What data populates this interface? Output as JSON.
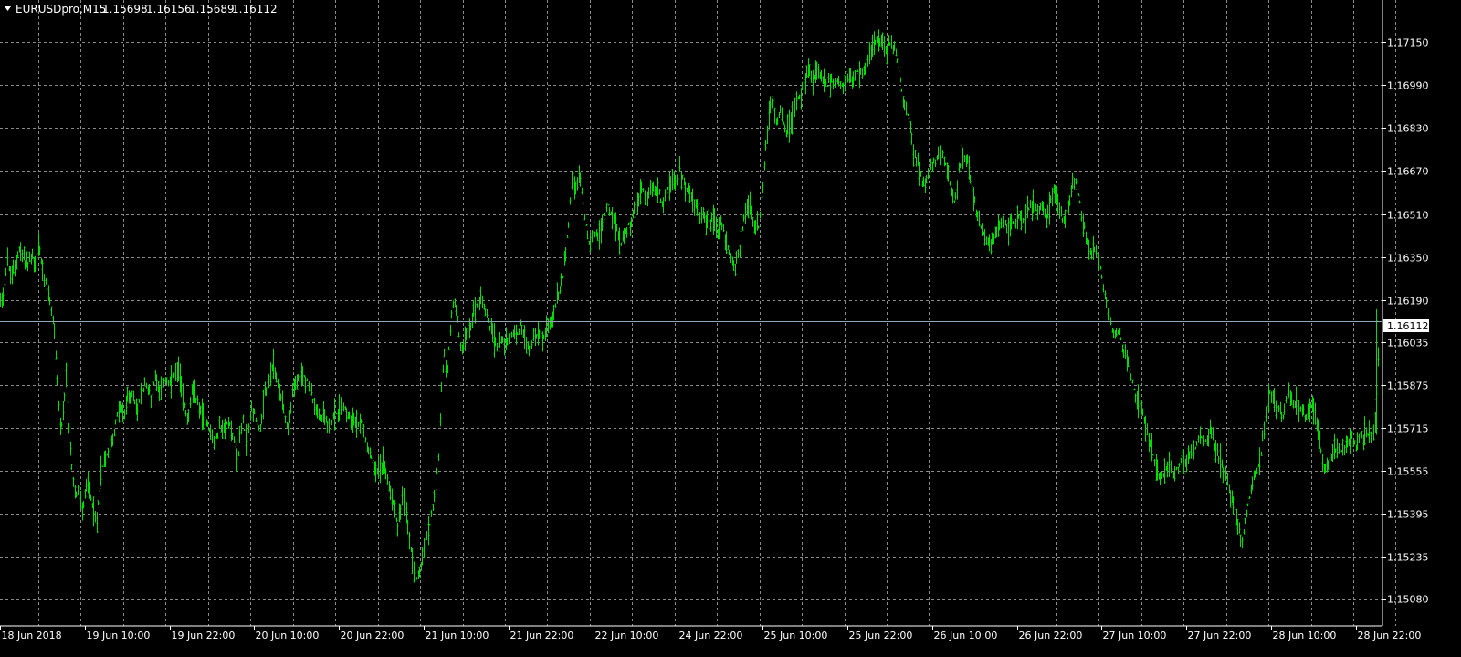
{
  "chart_window": {
    "symbol_label": "EURUSDpro,M15",
    "ohlc": [
      "1.15698",
      "1.16156",
      "1.15689",
      "1.16112"
    ],
    "current_price_label": "1.16112",
    "colors": {
      "background": "#000000",
      "bars": "#00dd00",
      "grid": "#8a8a8a",
      "text": "#ffffff",
      "current_price_line": "#8fa6b4"
    },
    "icons": {
      "collapse": "triangle-down-icon"
    }
  },
  "chart_data": {
    "type": "ohlc_bar",
    "title": "EURUSDpro,M15",
    "timeframe": "M15",
    "grid": true,
    "price_axis": {
      "position": "right",
      "ticks": [
        "1.17150",
        "1.16990",
        "1.16830",
        "1.16670",
        "1.16510",
        "1.16350",
        "1.16190",
        "1.16035",
        "1.15875",
        "1.15715",
        "1.15555",
        "1.15395",
        "1.15235",
        "1.15080"
      ],
      "range": [
        1.15,
        1.1735
      ]
    },
    "time_axis": {
      "position": "bottom",
      "ticks": [
        "18 Jun 2018",
        "19 Jun 10:00",
        "19 Jun 22:00",
        "20 Jun 10:00",
        "20 Jun 22:00",
        "21 Jun 10:00",
        "21 Jun 22:00",
        "22 Jun 10:00",
        "24 Jun 22:00",
        "25 Jun 10:00",
        "25 Jun 22:00",
        "26 Jun 10:00",
        "26 Jun 22:00",
        "27 Jun 10:00",
        "27 Jun 22:00",
        "28 Jun 10:00",
        "28 Jun 22:00"
      ]
    },
    "last_bar": {
      "open": 1.15698,
      "high": 1.16156,
      "low": 1.15689,
      "close": 1.16112
    },
    "current_price": 1.16112,
    "price_path": [
      [
        0,
        1.162
      ],
      [
        4,
        1.1622
      ],
      [
        8,
        1.1635
      ],
      [
        11,
        1.1627
      ],
      [
        15,
        1.163
      ],
      [
        20,
        1.1638
      ],
      [
        25,
        1.1635
      ],
      [
        30,
        1.1632
      ],
      [
        35,
        1.1636
      ],
      [
        38,
        1.163
      ],
      [
        42,
        1.164
      ],
      [
        47,
        1.1628
      ],
      [
        52,
        1.1622
      ],
      [
        56,
        1.1615
      ],
      [
        60,
        1.1605
      ],
      [
        63,
        1.1585
      ],
      [
        66,
        1.157
      ],
      [
        69,
        1.1575
      ],
      [
        72,
        1.159
      ],
      [
        75,
        1.1572
      ],
      [
        78,
        1.1558
      ],
      [
        82,
        1.1545
      ],
      [
        86,
        1.155
      ],
      [
        90,
        1.154
      ],
      [
        95,
        1.1552
      ],
      [
        100,
        1.1545
      ],
      [
        105,
        1.1535
      ],
      [
        110,
        1.1555
      ],
      [
        115,
        1.156
      ],
      [
        120,
        1.1565
      ],
      [
        125,
        1.157
      ],
      [
        130,
        1.158
      ],
      [
        135,
        1.1575
      ],
      [
        140,
        1.1585
      ],
      [
        145,
        1.1583
      ],
      [
        150,
        1.1578
      ],
      [
        155,
        1.1585
      ],
      [
        160,
        1.1588
      ],
      [
        165,
        1.1582
      ],
      [
        170,
        1.1592
      ],
      [
        175,
        1.1585
      ],
      [
        180,
        1.159
      ],
      [
        185,
        1.1587
      ],
      [
        190,
        1.159
      ],
      [
        195,
        1.1593
      ],
      [
        200,
        1.1583
      ],
      [
        205,
        1.1575
      ],
      [
        210,
        1.1585
      ],
      [
        215,
        1.1582
      ],
      [
        220,
        1.1577
      ],
      [
        225,
        1.1575
      ],
      [
        230,
        1.157
      ],
      [
        235,
        1.1565
      ],
      [
        240,
        1.1572
      ],
      [
        245,
        1.157
      ],
      [
        250,
        1.1575
      ],
      [
        255,
        1.1568
      ],
      [
        260,
        1.156
      ],
      [
        265,
        1.1575
      ],
      [
        270,
        1.1565
      ],
      [
        275,
        1.158
      ],
      [
        280,
        1.1575
      ],
      [
        285,
        1.157
      ],
      [
        290,
        1.1585
      ],
      [
        295,
        1.159
      ],
      [
        300,
        1.1595
      ],
      [
        305,
        1.1585
      ],
      [
        310,
        1.158
      ],
      [
        315,
        1.157
      ],
      [
        320,
        1.1585
      ],
      [
        325,
        1.1588
      ],
      [
        330,
        1.1592
      ],
      [
        335,
        1.159
      ],
      [
        340,
        1.1585
      ],
      [
        345,
        1.1578
      ],
      [
        350,
        1.1575
      ],
      [
        355,
        1.1577
      ],
      [
        360,
        1.1572
      ],
      [
        365,
        1.1575
      ],
      [
        370,
        1.1578
      ],
      [
        375,
        1.158
      ],
      [
        380,
        1.1578
      ],
      [
        385,
        1.1575
      ],
      [
        390,
        1.1572
      ],
      [
        395,
        1.1575
      ],
      [
        400,
        1.1568
      ],
      [
        405,
        1.1562
      ],
      [
        410,
        1.1558
      ],
      [
        415,
        1.1555
      ],
      [
        420,
        1.156
      ],
      [
        425,
        1.155
      ],
      [
        430,
        1.1545
      ],
      [
        435,
        1.1535
      ],
      [
        440,
        1.1545
      ],
      [
        445,
        1.154
      ],
      [
        450,
        1.1525
      ],
      [
        455,
        1.1515
      ],
      [
        460,
        1.152
      ],
      [
        465,
        1.1528
      ],
      [
        470,
        1.1535
      ],
      [
        475,
        1.1545
      ],
      [
        480,
        1.156
      ],
      [
        483,
        1.1585
      ],
      [
        486,
        1.16
      ],
      [
        489,
        1.159
      ],
      [
        492,
        1.1605
      ],
      [
        495,
        1.1615
      ],
      [
        498,
        1.162
      ],
      [
        501,
        1.161
      ],
      [
        505,
        1.16
      ],
      [
        510,
        1.1605
      ],
      [
        515,
        1.161
      ],
      [
        520,
        1.1615
      ],
      [
        525,
        1.162
      ],
      [
        530,
        1.1615
      ],
      [
        535,
        1.161
      ],
      [
        540,
        1.1605
      ],
      [
        545,
        1.1602
      ],
      [
        550,
        1.1605
      ],
      [
        555,
        1.1603
      ],
      [
        560,
        1.1607
      ],
      [
        565,
        1.1605
      ],
      [
        570,
        1.161
      ],
      [
        575,
        1.1605
      ],
      [
        580,
        1.16
      ],
      [
        585,
        1.1605
      ],
      [
        590,
        1.1607
      ],
      [
        595,
        1.1605
      ],
      [
        600,
        1.161
      ],
      [
        605,
        1.1612
      ],
      [
        610,
        1.162
      ],
      [
        615,
        1.1625
      ],
      [
        620,
        1.164
      ],
      [
        623,
        1.165
      ],
      [
        626,
        1.1665
      ],
      [
        630,
        1.166
      ],
      [
        635,
        1.1665
      ],
      [
        640,
        1.165
      ],
      [
        645,
        1.164
      ],
      [
        650,
        1.1645
      ],
      [
        655,
        1.1642
      ],
      [
        660,
        1.1648
      ],
      [
        665,
        1.1655
      ],
      [
        670,
        1.165
      ],
      [
        675,
        1.1645
      ],
      [
        680,
        1.164
      ],
      [
        685,
        1.1645
      ],
      [
        690,
        1.1648
      ],
      [
        695,
        1.1652
      ],
      [
        700,
        1.1658
      ],
      [
        705,
        1.166
      ],
      [
        710,
        1.1658
      ],
      [
        715,
        1.1662
      ],
      [
        720,
        1.166
      ],
      [
        725,
        1.1655
      ],
      [
        730,
        1.166
      ],
      [
        735,
        1.1662
      ],
      [
        740,
        1.1665
      ],
      [
        745,
        1.1667
      ],
      [
        750,
        1.1662
      ],
      [
        755,
        1.1658
      ],
      [
        760,
        1.1655
      ],
      [
        765,
        1.1652
      ],
      [
        770,
        1.165
      ],
      [
        775,
        1.1648
      ],
      [
        780,
        1.165
      ],
      [
        785,
        1.1645
      ],
      [
        790,
        1.1648
      ],
      [
        795,
        1.164
      ],
      [
        800,
        1.1635
      ],
      [
        805,
        1.163
      ],
      [
        810,
        1.164
      ],
      [
        815,
        1.165
      ],
      [
        820,
        1.1655
      ],
      [
        825,
        1.1648
      ],
      [
        830,
        1.1645
      ],
      [
        835,
        1.166
      ],
      [
        838,
        1.1675
      ],
      [
        842,
        1.169
      ],
      [
        846,
        1.1695
      ],
      [
        850,
        1.1685
      ],
      [
        855,
        1.169
      ],
      [
        860,
        1.168
      ],
      [
        865,
        1.1685
      ],
      [
        870,
        1.169
      ],
      [
        875,
        1.1695
      ],
      [
        880,
        1.17
      ],
      [
        885,
        1.1705
      ],
      [
        890,
        1.17
      ],
      [
        895,
        1.1705
      ],
      [
        900,
        1.1702
      ],
      [
        905,
        1.1698
      ],
      [
        910,
        1.1702
      ],
      [
        915,
        1.17
      ],
      [
        920,
        1.1698
      ],
      [
        925,
        1.17
      ],
      [
        930,
        1.1703
      ],
      [
        935,
        1.17
      ],
      [
        940,
        1.1705
      ],
      [
        945,
        1.1702
      ],
      [
        950,
        1.1708
      ],
      [
        955,
        1.1712
      ],
      [
        960,
        1.1716
      ],
      [
        965,
        1.1714
      ],
      [
        970,
        1.1712
      ],
      [
        975,
        1.1715
      ],
      [
        980,
        1.1712
      ],
      [
        984,
        1.1705
      ],
      [
        988,
        1.1695
      ],
      [
        992,
        1.169
      ],
      [
        996,
        1.1685
      ],
      [
        1000,
        1.1675
      ],
      [
        1005,
        1.167
      ],
      [
        1010,
        1.1662
      ],
      [
        1015,
        1.1665
      ],
      [
        1020,
        1.1668
      ],
      [
        1025,
        1.1672
      ],
      [
        1030,
        1.1675
      ],
      [
        1035,
        1.167
      ],
      [
        1040,
        1.1662
      ],
      [
        1045,
        1.1655
      ],
      [
        1050,
        1.1668
      ],
      [
        1055,
        1.1672
      ],
      [
        1060,
        1.167
      ],
      [
        1065,
        1.166
      ],
      [
        1070,
        1.165
      ],
      [
        1075,
        1.1645
      ],
      [
        1080,
        1.1642
      ],
      [
        1085,
        1.164
      ],
      [
        1090,
        1.1645
      ],
      [
        1095,
        1.1648
      ],
      [
        1100,
        1.1647
      ],
      [
        1105,
        1.1645
      ],
      [
        1110,
        1.1648
      ],
      [
        1115,
        1.165
      ],
      [
        1120,
        1.1648
      ],
      [
        1125,
        1.1652
      ],
      [
        1130,
        1.1655
      ],
      [
        1135,
        1.1652
      ],
      [
        1140,
        1.1655
      ],
      [
        1145,
        1.165
      ],
      [
        1150,
        1.1655
      ],
      [
        1155,
        1.166
      ],
      [
        1160,
        1.1652
      ],
      [
        1165,
        1.1648
      ],
      [
        1170,
        1.1655
      ],
      [
        1175,
        1.1665
      ],
      [
        1180,
        1.166
      ],
      [
        1185,
        1.165
      ],
      [
        1190,
        1.164
      ],
      [
        1195,
        1.1635
      ],
      [
        1200,
        1.1638
      ],
      [
        1205,
        1.163
      ],
      [
        1210,
        1.162
      ],
      [
        1215,
        1.1612
      ],
      [
        1220,
        1.1605
      ],
      [
        1225,
        1.1608
      ],
      [
        1230,
        1.16
      ],
      [
        1235,
        1.1595
      ],
      [
        1240,
        1.1588
      ],
      [
        1245,
        1.1582
      ],
      [
        1250,
        1.1578
      ],
      [
        1255,
        1.157
      ],
      [
        1260,
        1.1565
      ],
      [
        1265,
        1.1558
      ],
      [
        1270,
        1.1552
      ],
      [
        1275,
        1.1555
      ],
      [
        1280,
        1.1558
      ],
      [
        1285,
        1.1555
      ],
      [
        1290,
        1.1557
      ],
      [
        1295,
        1.156
      ],
      [
        1300,
        1.1558
      ],
      [
        1305,
        1.1562
      ],
      [
        1310,
        1.1565
      ],
      [
        1315,
        1.1568
      ],
      [
        1320,
        1.1567
      ],
      [
        1325,
        1.157
      ],
      [
        1330,
        1.1565
      ],
      [
        1335,
        1.156
      ],
      [
        1340,
        1.1555
      ],
      [
        1345,
        1.155
      ],
      [
        1350,
        1.1545
      ],
      [
        1355,
        1.1535
      ],
      [
        1360,
        1.153
      ],
      [
        1365,
        1.154
      ],
      [
        1370,
        1.155
      ],
      [
        1375,
        1.1555
      ],
      [
        1380,
        1.156
      ],
      [
        1385,
        1.1575
      ],
      [
        1390,
        1.1585
      ],
      [
        1395,
        1.1582
      ],
      [
        1400,
        1.1578
      ],
      [
        1405,
        1.1575
      ],
      [
        1410,
        1.1585
      ],
      [
        1415,
        1.158
      ],
      [
        1420,
        1.1582
      ],
      [
        1425,
        1.1578
      ],
      [
        1430,
        1.1575
      ],
      [
        1435,
        1.158
      ],
      [
        1440,
        1.1578
      ],
      [
        1445,
        1.1565
      ],
      [
        1450,
        1.1555
      ],
      [
        1455,
        1.1558
      ],
      [
        1460,
        1.1562
      ],
      [
        1465,
        1.1565
      ],
      [
        1470,
        1.1562
      ],
      [
        1475,
        1.1565
      ],
      [
        1480,
        1.1568
      ],
      [
        1485,
        1.1565
      ],
      [
        1490,
        1.1567
      ],
      [
        1495,
        1.157
      ],
      [
        1500,
        1.1568
      ],
      [
        1505,
        1.157
      ],
      [
        1508,
        1.159
      ],
      [
        1510,
        1.1611
      ]
    ]
  }
}
